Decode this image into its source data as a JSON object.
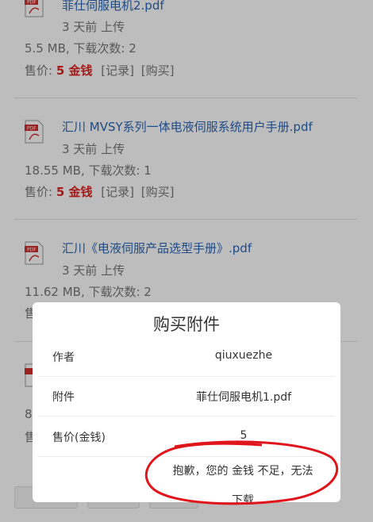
{
  "attachments": [
    {
      "name": "菲仕伺服电机2.pdf",
      "time": "3 天前 上传",
      "meta": "5.5 MB, 下载次数: 2",
      "price_label": "售价:",
      "price_value": "5 金钱",
      "log": "[记录]",
      "buy": "[购买]"
    },
    {
      "name": "汇川 MVSY系列一体电液伺服系统用户手册.pdf",
      "time": "3 天前 上传",
      "meta": "18.55 MB, 下载次数: 1",
      "price_label": "售价:",
      "price_value": "5 金钱",
      "log": "[记录]",
      "buy": "[购买]"
    },
    {
      "name": "汇川《电液伺服产品选型手册》.pdf",
      "time": "3 天前 上传",
      "meta": "11.62 MB, 下载次数: 2",
      "price_label": "售",
      "price_value": "",
      "log": "",
      "buy": ""
    }
  ],
  "peek": {
    "a": "8",
    "b": "售"
  },
  "dialog": {
    "title": "购买附件",
    "rows": [
      {
        "label": "作者",
        "value": "qiuxuezhe"
      },
      {
        "label": "附件",
        "value": "菲仕伺服电机1.pdf"
      },
      {
        "label": "售价(金钱)",
        "value": "5"
      }
    ],
    "message_line1": "抱歉，您的 金钱 不足，无法",
    "message_line2": "下载"
  },
  "icons": {
    "pdf": "pdf-file-icon"
  },
  "colors": {
    "link": "#2a66b5",
    "price": "#e02323",
    "annotation": "#e0151b"
  }
}
